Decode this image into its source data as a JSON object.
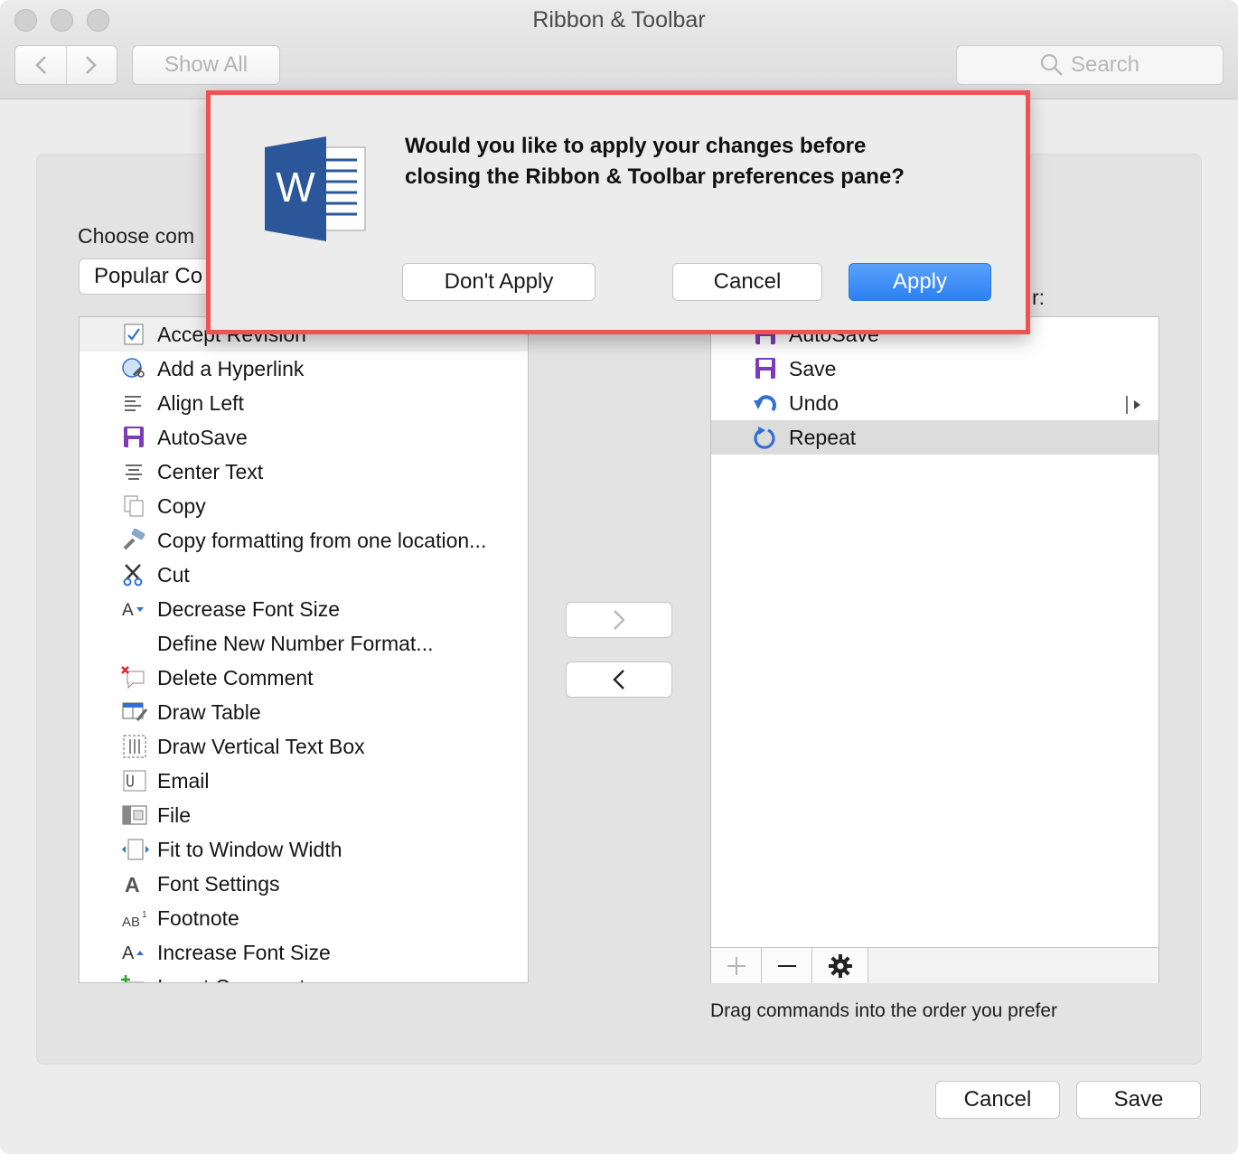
{
  "window": {
    "title": "Ribbon & Toolbar"
  },
  "toolbar": {
    "show_all": "Show All",
    "search_placeholder": "Search"
  },
  "left": {
    "choose_label": "Choose com",
    "popup_value": "Popular Co",
    "items": [
      {
        "label": "Accept Revision",
        "icon": "accept-revision-icon"
      },
      {
        "label": "Add a Hyperlink",
        "icon": "hyperlink-icon"
      },
      {
        "label": "Align Left",
        "icon": "align-left-icon"
      },
      {
        "label": "AutoSave",
        "icon": "autosave-icon"
      },
      {
        "label": "Center Text",
        "icon": "center-text-icon"
      },
      {
        "label": "Copy",
        "icon": "copy-icon"
      },
      {
        "label": "Copy formatting from one location...",
        "icon": "format-painter-icon"
      },
      {
        "label": "Cut",
        "icon": "scissors-icon"
      },
      {
        "label": "Decrease Font Size",
        "icon": "decrease-font-icon"
      },
      {
        "label": "Define New Number Format...",
        "icon": ""
      },
      {
        "label": "Delete Comment",
        "icon": "delete-comment-icon"
      },
      {
        "label": "Draw Table",
        "icon": "draw-table-icon"
      },
      {
        "label": "Draw Vertical Text Box",
        "icon": "vertical-textbox-icon"
      },
      {
        "label": "Email",
        "icon": "email-icon"
      },
      {
        "label": "File",
        "icon": "file-icon"
      },
      {
        "label": "Fit to Window Width",
        "icon": "fit-width-icon"
      },
      {
        "label": "Font Settings",
        "icon": "font-settings-icon"
      },
      {
        "label": "Footnote",
        "icon": "footnote-icon"
      },
      {
        "label": "Increase Font Size",
        "icon": "increase-font-icon"
      },
      {
        "label": "Insert Comment",
        "icon": "insert-comment-icon"
      }
    ]
  },
  "right": {
    "label_fragment": "r:",
    "items": [
      {
        "label": "AutoSave",
        "icon": "autosave-icon"
      },
      {
        "label": "Save",
        "icon": "save-icon"
      },
      {
        "label": "Undo",
        "icon": "undo-icon"
      },
      {
        "label": "Repeat",
        "icon": "repeat-icon"
      }
    ],
    "selected_index": 3,
    "hint": "Drag commands into the order you prefer"
  },
  "buttons": {
    "cancel": "Cancel",
    "save": "Save"
  },
  "dialog": {
    "message_line1": "Would you like to apply your changes before",
    "message_line2": "closing the Ribbon & Toolbar preferences pane?",
    "dont_apply": "Don't Apply",
    "cancel": "Cancel",
    "apply": "Apply",
    "app_icon": "word-app-icon",
    "app_letter": "W"
  },
  "colors": {
    "accent": "#2c7ff3",
    "highlight_border": "#f05252",
    "word_blue": "#2b579a"
  }
}
